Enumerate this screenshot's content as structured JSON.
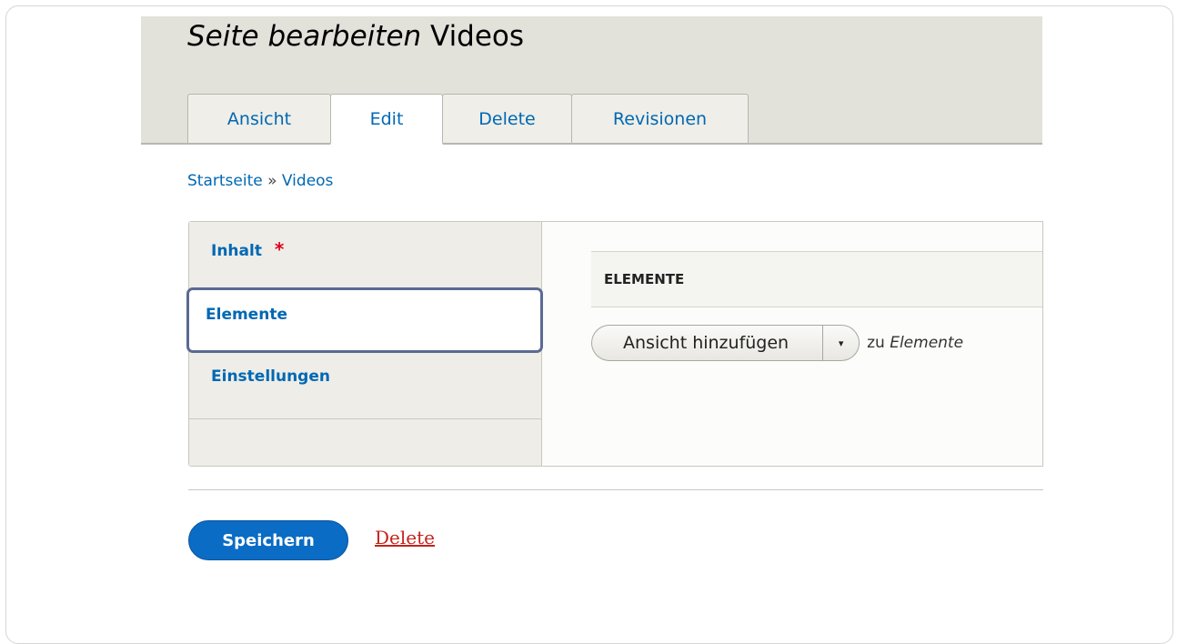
{
  "header": {
    "title_italic": "Seite bearbeiten",
    "title_rest": "Videos",
    "tabs": [
      {
        "label": "Ansicht",
        "active": false
      },
      {
        "label": "Edit",
        "active": true
      },
      {
        "label": "Delete",
        "active": false
      },
      {
        "label": "Revisionen",
        "active": false
      }
    ]
  },
  "breadcrumb": {
    "home": "Startseite",
    "separator": "»",
    "current": "Videos"
  },
  "vertical_tabs": {
    "items": [
      {
        "label": "Inhalt",
        "required_marker": "*"
      },
      {
        "label": "Elemente",
        "selected": true
      },
      {
        "label": "Einstellungen"
      }
    ]
  },
  "panel": {
    "fieldset_title": "ELEMENTE",
    "add_view_button": "Ansicht hinzufügen",
    "toggle_icon": "▾",
    "suffix_prefix": "zu",
    "suffix_target": "Elemente"
  },
  "actions": {
    "save_label": "Speichern",
    "delete_label": "Delete"
  },
  "colors": {
    "link": "#0068b3",
    "primary_button": "#0a6cc4",
    "danger_link": "#c4231a",
    "required": "#e0001b",
    "focus_outline": "#5a6a92"
  }
}
